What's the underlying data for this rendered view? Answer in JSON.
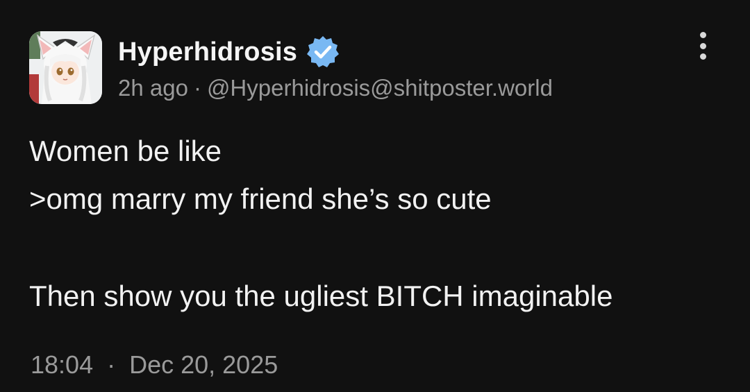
{
  "author": {
    "display_name": "Hyperhidrosis",
    "verified": true,
    "time_ago": "2h ago",
    "separator": "·",
    "handle": "@Hyperhidrosis@shitposter.world",
    "avatar_icon": "anime-girl-avatar"
  },
  "menu": {
    "icon": "more-vertical-icon"
  },
  "post": {
    "lines": [
      "Women be like",
      ">omg marry my friend she’s so cute",
      "",
      "Then show you the ugliest BITCH imaginable"
    ]
  },
  "footer": {
    "time": "18:04",
    "separator": "·",
    "date": "Dec 20, 2025"
  },
  "colors": {
    "background": "#111111",
    "verified_badge": "#79b8f3",
    "muted_text": "#9a9a9a",
    "primary_text": "#f2f2f2"
  }
}
